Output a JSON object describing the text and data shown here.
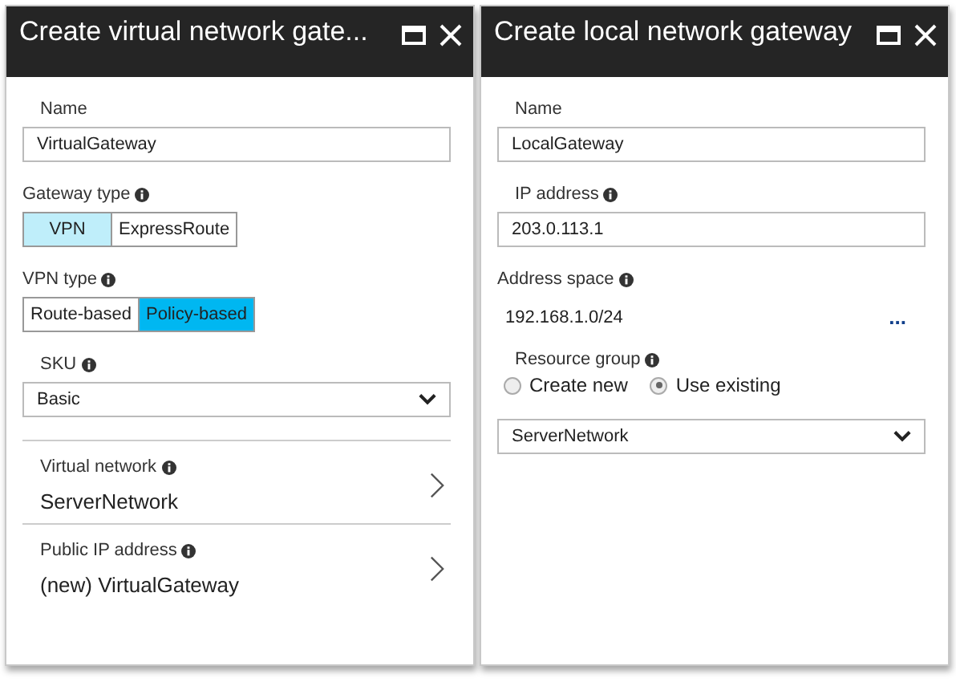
{
  "panels": [
    {
      "title": "Create virtual network gate...",
      "fields": [
        {
          "kind": "text",
          "label": "Name",
          "value": "VirtualGateway"
        },
        {
          "kind": "segmented",
          "label": "Gateway type",
          "info": true,
          "focused": false,
          "options": [
            {
              "label": "VPN",
              "selected": true
            },
            {
              "label": "ExpressRoute",
              "selected": false
            }
          ]
        },
        {
          "kind": "segmented",
          "label": "VPN type",
          "info": true,
          "focused": true,
          "options": [
            {
              "label": "Route-based",
              "selected": false
            },
            {
              "label": "Policy-based",
              "selected": true
            }
          ]
        },
        {
          "kind": "select",
          "label": "SKU",
          "info": true,
          "value": "Basic"
        },
        {
          "kind": "nav",
          "label": "Virtual network",
          "info": true,
          "value": "ServerNetwork"
        },
        {
          "kind": "nav",
          "label": "Public IP address",
          "info": true,
          "value": "(new) VirtualGateway"
        }
      ]
    },
    {
      "title": "Create local network gateway",
      "fields": [
        {
          "kind": "text",
          "label": "Name",
          "value": "LocalGateway"
        },
        {
          "kind": "text",
          "label": "IP address",
          "info": true,
          "value": "203.0.113.1"
        },
        {
          "kind": "list",
          "label": "Address space",
          "info": true,
          "value": "192.168.1.0/24",
          "more": "..."
        },
        {
          "kind": "radios",
          "label": "Resource group",
          "info": true,
          "options": [
            {
              "label": "Create new",
              "selected": false
            },
            {
              "label": "Use existing",
              "selected": true
            }
          ]
        },
        {
          "kind": "select",
          "value": "ServerNetwork"
        }
      ]
    }
  ]
}
